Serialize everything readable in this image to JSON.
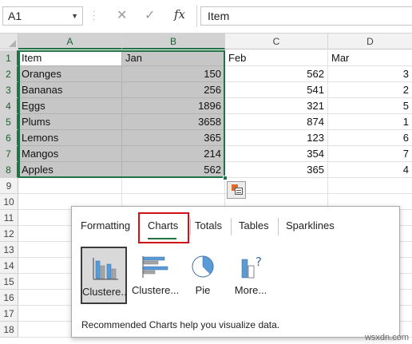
{
  "formula_bar": {
    "name_box": "A1",
    "cancel_glyph": "✕",
    "enter_glyph": "✓",
    "fx_label": "fx",
    "formula_value": "Item"
  },
  "columns": [
    "A",
    "B",
    "C",
    "D"
  ],
  "rows": [
    "1",
    "2",
    "3",
    "4",
    "5",
    "6",
    "7",
    "8",
    "9",
    "10",
    "11",
    "12",
    "13",
    "14",
    "15",
    "16",
    "17",
    "18"
  ],
  "sheet": {
    "header": [
      "Item",
      "Jan",
      "Feb",
      "Mar"
    ],
    "data": [
      [
        "Oranges",
        "150",
        "562",
        "3"
      ],
      [
        "Bananas",
        "256",
        "541",
        "2"
      ],
      [
        "Eggs",
        "1896",
        "321",
        "5"
      ],
      [
        "Plums",
        "3658",
        "874",
        "1"
      ],
      [
        "Lemons",
        "365",
        "123",
        "6"
      ],
      [
        "Mangos",
        "214",
        "354",
        "7"
      ],
      [
        "Apples",
        "562",
        "365",
        "4"
      ]
    ]
  },
  "quick_analysis": {
    "tabs": [
      "Formatting",
      "Charts",
      "Totals",
      "Tables",
      "Sparklines"
    ],
    "active_tab": "Charts",
    "options": [
      {
        "label": "Clustere...",
        "icon": "clustered-column-chart-icon"
      },
      {
        "label": "Clustere...",
        "icon": "clustered-bar-chart-icon"
      },
      {
        "label": "Pie",
        "icon": "pie-chart-icon"
      },
      {
        "label": "More...",
        "icon": "more-charts-icon"
      }
    ],
    "description": "Recommended Charts help you visualize data."
  },
  "watermark": "wsxdn.com",
  "colors": {
    "selection_border": "#217346",
    "highlight_box": "#d0101b",
    "selected_fill": "#c6c6c6",
    "chart_blue": "#5b9bd5",
    "chart_gray": "#a5a5a5"
  }
}
